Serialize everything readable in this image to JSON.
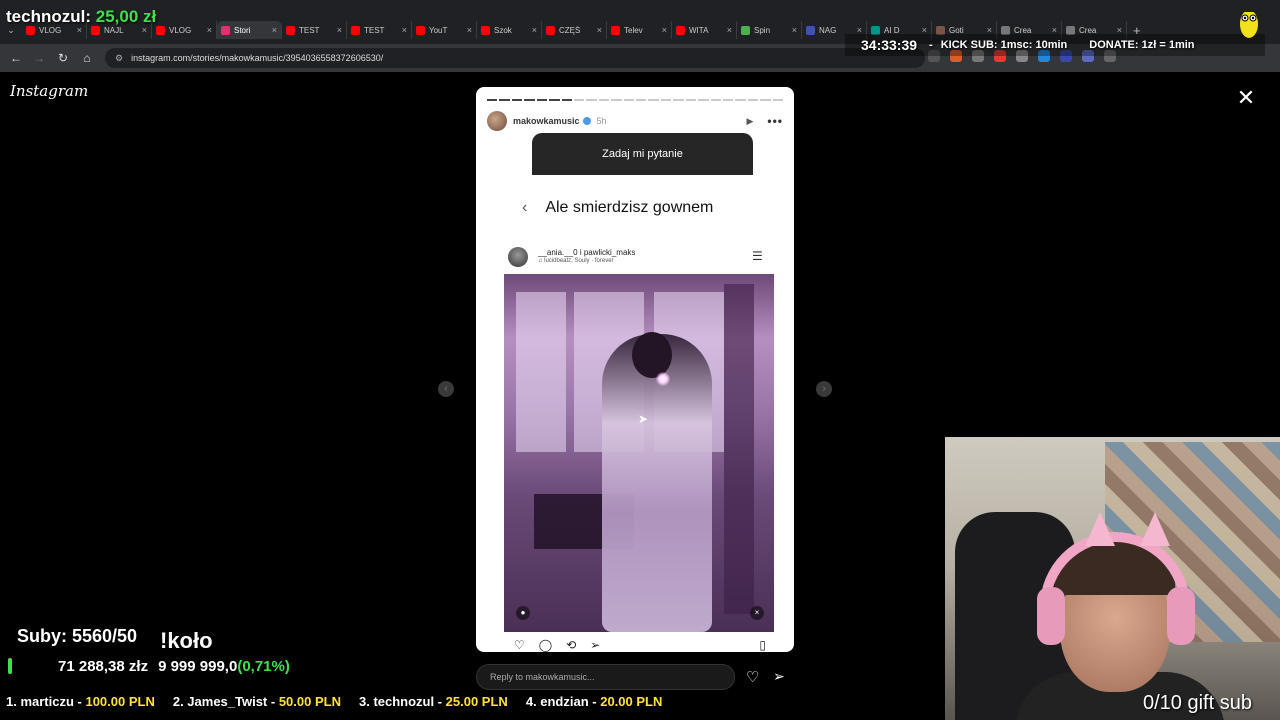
{
  "browser": {
    "tabs": [
      {
        "title": "VLOG",
        "color": "#ff0000",
        "active": false
      },
      {
        "title": "NAJL",
        "color": "#ff0000",
        "active": false
      },
      {
        "title": "VLOG",
        "color": "#ff0000",
        "active": false
      },
      {
        "title": "Stori",
        "color": "#e1306c",
        "active": true
      },
      {
        "title": "TEST",
        "color": "#ff0000",
        "active": false
      },
      {
        "title": "TEST",
        "color": "#ff0000",
        "active": false
      },
      {
        "title": "YouT",
        "color": "#ff0000",
        "active": false
      },
      {
        "title": "Szok",
        "color": "#ff0000",
        "active": false
      },
      {
        "title": "CZĘŚ",
        "color": "#ff0000",
        "active": false
      },
      {
        "title": "Telev",
        "color": "#ff0000",
        "active": false
      },
      {
        "title": "WITA",
        "color": "#ff0000",
        "active": false
      },
      {
        "title": "Spin",
        "color": "#4caf50",
        "active": false
      },
      {
        "title": "NAG",
        "color": "#3f51b5",
        "active": false
      },
      {
        "title": "AI D",
        "color": "#009688",
        "active": false
      },
      {
        "title": "Goti",
        "color": "#795548",
        "active": false
      },
      {
        "title": "Crea",
        "color": "#777777",
        "active": false
      },
      {
        "title": "Crea",
        "color": "#777777",
        "active": false
      }
    ],
    "new_tab": "+",
    "url": "instagram.com/stories/makowkamusic/3954036558372606530/",
    "extension_colors": [
      "#555555",
      "#e05a2b",
      "#777777",
      "#e53935",
      "#888888",
      "#1e88e5",
      "#3949ab",
      "#5c6bc0",
      "#666666"
    ]
  },
  "stream": {
    "top_donor": "technozul:",
    "top_amount": "25,00 zł",
    "timer": "34:33:39",
    "timer_sep": "-",
    "kick_sub": "KICK SUB: 1msc: 10min",
    "donate": "DONATE: 1zł = 1min",
    "subs": "Suby: 5560/50",
    "kolo": "!koło",
    "goal_current": "71 288,38 złz",
    "goal_target": "9 999 999,0",
    "goal_pct": "(0,71%)",
    "leaderboard": [
      {
        "rank_name": "1. marticzu - ",
        "amount": "100.00 PLN"
      },
      {
        "rank_name": "2. James_Twist - ",
        "amount": "50.00 PLN"
      },
      {
        "rank_name": "3. technozul - ",
        "amount": "25.00 PLN"
      },
      {
        "rank_name": "4. endzian - ",
        "amount": "20.00 PLN"
      }
    ],
    "gift_sub": "0/10 gift sub"
  },
  "instagram": {
    "logo": "Instagram",
    "close": "✕",
    "story": {
      "segments_total": 24,
      "segments_done": 7,
      "username": "makowkamusic",
      "time": "5h",
      "question": "Zadaj mi pytanie",
      "answer": "Ale smierdzisz gownem",
      "post_user": "__ania.__0 i pawlicki_maks",
      "post_music": "♫ lucidbeatz, Souly · forever"
    },
    "reply_placeholder": "Reply to makowkamusic..."
  }
}
